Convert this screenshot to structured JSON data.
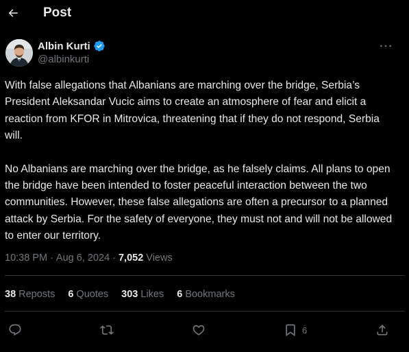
{
  "header": {
    "title": "Post",
    "back_icon": "arrow-left-icon"
  },
  "author": {
    "name": "Albin Kurti",
    "handle": "@albinkurti",
    "verified": true,
    "verified_color": "#1d9bf0"
  },
  "post": {
    "paragraphs": [
      "With false allegations that Albanians are marching over the bridge, Serbia’s President Aleksandar Vucic aims to create an atmosphere of fear and elicit a reaction from KFOR in Mitrovica, threatening that if they do not respond, Serbia will.",
      "No Albanians are marching over the bridge, as he falsely claims. All plans to open the bridge have been intended to foster peaceful interaction between the two communities. However, these false allegations are often a precursor to a planned attack by Serbia. For the safety of everyone, they must not and will not be allowed to enter our territory."
    ],
    "time": "10:38 PM",
    "date": "Aug 6, 2024",
    "separator": "·",
    "views_count": "7,052",
    "views_label": "Views"
  },
  "stats": {
    "reposts": {
      "count": "38",
      "label": "Reposts"
    },
    "quotes": {
      "count": "6",
      "label": "Quotes"
    },
    "likes": {
      "count": "303",
      "label": "Likes"
    },
    "bookmarks": {
      "count": "6",
      "label": "Bookmarks"
    }
  },
  "actions": {
    "bookmark_count": "6"
  },
  "colors": {
    "background": "#000000",
    "text": "#e7e9ea",
    "muted": "#71767b",
    "divider": "#2f3336"
  }
}
